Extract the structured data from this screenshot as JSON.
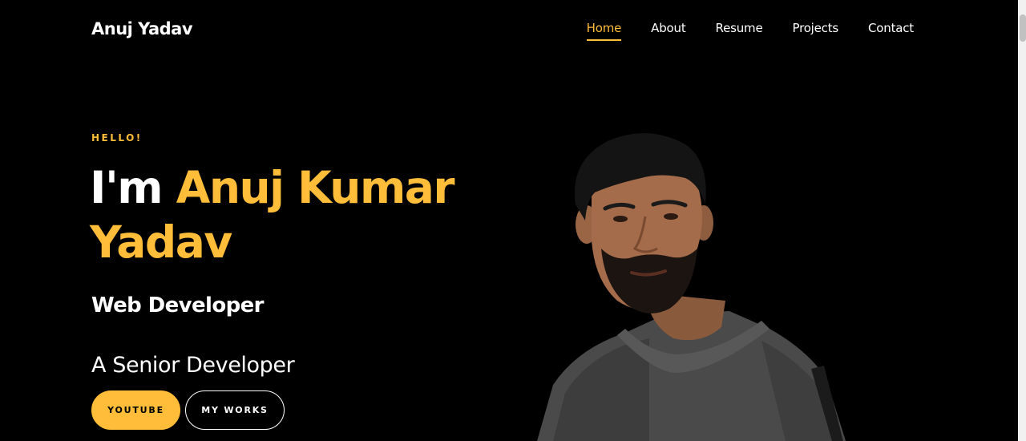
{
  "brand": "Anuj Yadav",
  "nav": [
    {
      "label": "Home",
      "active": true
    },
    {
      "label": "About"
    },
    {
      "label": "Resume"
    },
    {
      "label": "Projects"
    },
    {
      "label": "Contact"
    }
  ],
  "hero": {
    "greeting": "HELLO!",
    "title_prefix": "I'm ",
    "title_name": "Anuj Kumar Yadav",
    "role": "Web Developer",
    "tagline": "A Senior Developer",
    "buttons": {
      "primary": "YOUTUBE",
      "secondary": "MY WORKS"
    }
  },
  "colors": {
    "accent": "#ffbd39",
    "background": "#000000",
    "text": "#ffffff"
  },
  "icons": {
    "portrait": "person-portrait"
  }
}
